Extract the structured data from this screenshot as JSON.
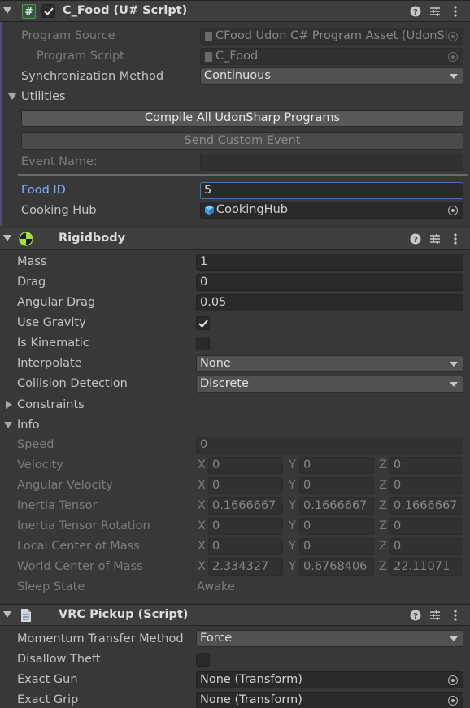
{
  "udon": {
    "title": "C_Food (U# Script)",
    "program_source_label": "Program Source",
    "program_source_value": "CFood Udon C# Program Asset (UdonSl",
    "program_script_label": "Program Script",
    "program_script_value": "C_Food",
    "sync_label": "Synchronization Method",
    "sync_value": "Continuous",
    "utilities_label": "Utilities",
    "compile_button": "Compile All UdonSharp Programs",
    "send_event_button": "Send Custom Event",
    "event_name_label": "Event Name:",
    "event_name_value": "",
    "food_id_label": "Food ID",
    "food_id_value": "5",
    "cooking_hub_label": "Cooking Hub",
    "cooking_hub_value": "CookingHub"
  },
  "rigidbody": {
    "title": "Rigidbody",
    "mass_label": "Mass",
    "mass_value": "1",
    "drag_label": "Drag",
    "drag_value": "0",
    "angular_drag_label": "Angular Drag",
    "angular_drag_value": "0.05",
    "use_gravity_label": "Use Gravity",
    "use_gravity_checked": true,
    "is_kinematic_label": "Is Kinematic",
    "is_kinematic_checked": false,
    "interpolate_label": "Interpolate",
    "interpolate_value": "None",
    "collision_label": "Collision Detection",
    "collision_value": "Discrete",
    "constraints_label": "Constraints",
    "info_label": "Info",
    "speed_label": "Speed",
    "speed_value": "0",
    "vectors": [
      {
        "label": "Velocity",
        "x": "0",
        "y": "0",
        "z": "0"
      },
      {
        "label": "Angular Velocity",
        "x": "0",
        "y": "0",
        "z": "0"
      },
      {
        "label": "Inertia Tensor",
        "x": "0.1666667",
        "y": "0.1666667",
        "z": "0.1666667"
      },
      {
        "label": "Inertia Tensor Rotation",
        "x": "0",
        "y": "0",
        "z": "0"
      },
      {
        "label": "Local Center of Mass",
        "x": "0",
        "y": "0",
        "z": "0"
      },
      {
        "label": "World Center of Mass",
        "x": "2.334327",
        "y": "0.6768406",
        "z": "22.11071"
      }
    ],
    "axis_x": "X",
    "axis_y": "Y",
    "axis_z": "Z",
    "sleep_label": "Sleep State",
    "sleep_value": "Awake"
  },
  "pickup": {
    "title": "VRC Pickup (Script)",
    "momentum_label": "Momentum Transfer Method",
    "momentum_value": "Force",
    "disallow_label": "Disallow Theft",
    "disallow_checked": false,
    "exact_gun_label": "Exact Gun",
    "exact_gun_value": "None (Transform)",
    "exact_grip_label": "Exact Grip",
    "exact_grip_value": "None (Transform)"
  },
  "colors": {
    "accent": "#3a79bb",
    "label_blue": "#7fb0ff",
    "background": "#383838"
  },
  "icons": [
    "hash-script-icon",
    "rigidbody-icon",
    "script-file-icon",
    "help-icon",
    "preset-icon",
    "more-icon",
    "cube-icon",
    "object-picker-icon"
  ]
}
